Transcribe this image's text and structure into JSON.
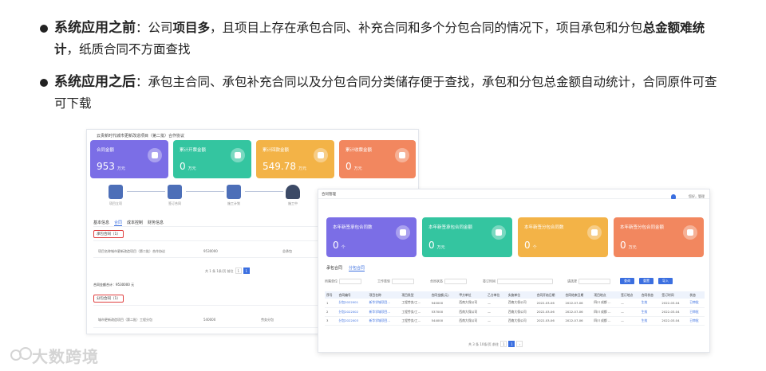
{
  "bullets": {
    "before": {
      "head": "系统应用之前",
      "colon": "：",
      "t1": "公司",
      "b1": "项目多",
      "t2": "，且项目上存在承包合同、补充合同和多个分包合同的情况下，项目承包和分包",
      "b2": "总金额难统计",
      "t3": "，纸质合同不方面查找"
    },
    "after": {
      "head": "系统应用之后",
      "colon": "：",
      "t1": "承包主合同、承包补充合同以及分包合同分类储存便于查找，承包和分包总金额自动统计，合同原件可查可下载"
    }
  },
  "pane_a": {
    "crumb": "云贵新时代城市更新改造项目（第二批）合作协议",
    "cards": [
      {
        "label": "合同金额",
        "value": "953",
        "unit": "万元",
        "color": "#7b6ee6"
      },
      {
        "label": "累计开票金额",
        "value": "0",
        "unit": "万元",
        "color": "#34c5a0"
      },
      {
        "label": "累计回款金额",
        "value": "549.78",
        "unit": "万元",
        "color": "#f3b347"
      },
      {
        "label": "累计收票金额",
        "value": "0",
        "unit": "万元",
        "color": "#f2875f"
      }
    ],
    "steps": [
      "项目立项",
      "签订合同",
      "施工计划",
      "施工中"
    ],
    "tabs": [
      "基本信息",
      "合同",
      "成本控制",
      "财务信息"
    ],
    "active_tab": "合同",
    "contract_box": "承包合同（1）",
    "row1": "项目名称城市更新改造项目（第二批）合作协议",
    "row1_amt": "9530000",
    "row1_type": "总承包",
    "pager": "共 1 条   1条/页   前往",
    "subtotal": "合同金额合计：9530000 元",
    "sub_box": "分包合同（1）",
    "row2": "城市更新改造项目（第二批）工程分包",
    "row2_amt": "540000",
    "row2_type": "劳务分包"
  },
  "pane_b": {
    "title": "合同管理",
    "user": "您好，管理",
    "cards": [
      {
        "label": "本年新签承包合同数",
        "value": "0",
        "unit": "个",
        "color": "#7b6ee6"
      },
      {
        "label": "本年新签承包合同金额",
        "value": "0",
        "unit": "万元",
        "color": "#34c5a0"
      },
      {
        "label": "本年新签分包合同数",
        "value": "0",
        "unit": "个",
        "color": "#f3b347"
      },
      {
        "label": "本年新签分包合同金额",
        "value": "0",
        "unit": "万元",
        "color": "#f2875f"
      }
    ],
    "tabs": [
      "承包合同",
      "分包合同"
    ],
    "active_tab": "分包合同",
    "filters": [
      "所属单位",
      "工作类型",
      "合同状态",
      "签订时间",
      "请选择"
    ],
    "buttons": [
      "查询",
      "重置",
      "导入"
    ],
    "columns": [
      "序号",
      "合同编号",
      "项目名称",
      "项目类型",
      "合同金额(元)",
      "甲方单位",
      "乙方单位",
      "实施单位",
      "合同开始日期",
      "合同结束日期",
      "项目地点",
      "签订地点",
      "合同状态",
      "签订时间",
      "状态"
    ],
    "rows": [
      [
        "1",
        "分包2022001",
        "新华学城项目...",
        "工程劳务/工...",
        "940000",
        "西南大保公司",
        "—",
        "西南大保公司",
        "2022-03-06",
        "2022-07-06",
        "四川 成都 ...",
        "—",
        "生效",
        "2022-03-04",
        "已审批"
      ],
      [
        "2",
        "分包2022002",
        "新华学城项目...",
        "工程劳务/工...",
        "537000",
        "西南大保公司",
        "—",
        "西南大保公司",
        "2022-03-06",
        "2022-07-06",
        "四川 成都 ...",
        "—",
        "生效",
        "2022-03-04",
        "已审批"
      ],
      [
        "3",
        "分包2022003",
        "新华学城项目...",
        "工程劳务/工...",
        "544000",
        "西南大保公司",
        "—",
        "西南大保公司",
        "2022-03-06",
        "2022-07-06",
        "四川 成都 ...",
        "—",
        "生效",
        "2022-03-04",
        "已审批"
      ]
    ],
    "pager": "共 3 条   10条/页   前往"
  },
  "watermark": "大数跨境"
}
